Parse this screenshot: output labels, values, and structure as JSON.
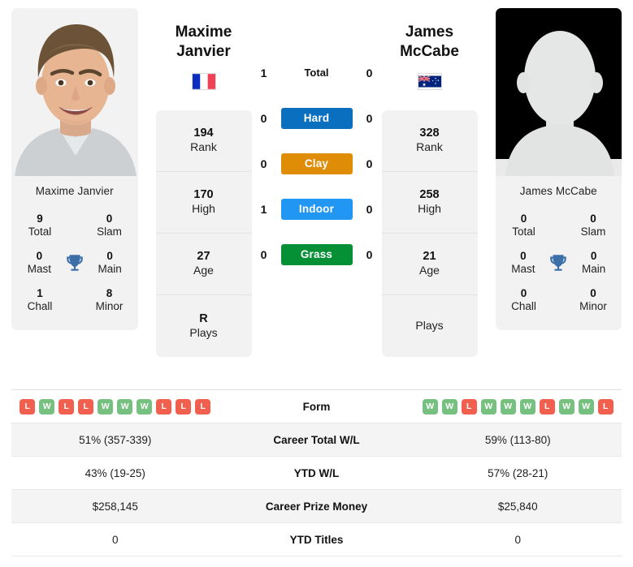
{
  "players": {
    "left": {
      "first_name": "Maxime",
      "last_name": "Janvier",
      "full_name": "Maxime Janvier",
      "country": "France",
      "flag": "fr-flag",
      "photo": "player-photo-janvier",
      "rank": "194",
      "rank_label": "Rank",
      "high": "170",
      "high_label": "High",
      "age": "27",
      "age_label": "Age",
      "plays": "R",
      "plays_label": "Plays",
      "titles": {
        "total_value": "9",
        "total_label": "Total",
        "slam_value": "0",
        "slam_label": "Slam",
        "mast_value": "0",
        "mast_label": "Mast",
        "main_value": "0",
        "main_label": "Main",
        "chall_value": "1",
        "chall_label": "Chall",
        "minor_value": "8",
        "minor_label": "Minor"
      },
      "form": [
        "L",
        "W",
        "L",
        "L",
        "W",
        "W",
        "W",
        "L",
        "L",
        "L"
      ],
      "career_wl": "51% (357-339)",
      "ytd_wl": "43% (19-25)",
      "career_prize": "$258,145",
      "ytd_titles": "0"
    },
    "right": {
      "first_name": "James",
      "last_name": "McCabe",
      "full_name": "James McCabe",
      "country": "Australia",
      "flag": "au-flag",
      "photo": "player-photo-placeholder",
      "rank": "328",
      "rank_label": "Rank",
      "high": "258",
      "high_label": "High",
      "age": "21",
      "age_label": "Age",
      "plays": "",
      "plays_label": "Plays",
      "titles": {
        "total_value": "0",
        "total_label": "Total",
        "slam_value": "0",
        "slam_label": "Slam",
        "mast_value": "0",
        "mast_label": "Mast",
        "main_value": "0",
        "main_label": "Main",
        "chall_value": "0",
        "chall_label": "Chall",
        "minor_value": "0",
        "minor_label": "Minor"
      },
      "form": [
        "W",
        "W",
        "L",
        "W",
        "W",
        "W",
        "L",
        "W",
        "W",
        "L"
      ],
      "career_wl": "59% (113-80)",
      "ytd_wl": "57% (28-21)",
      "career_prize": "$25,840",
      "ytd_titles": "0"
    }
  },
  "h2h": {
    "rows": [
      {
        "label": "Total",
        "left": "1",
        "right": "0",
        "type": "total",
        "color": ""
      },
      {
        "label": "Hard",
        "left": "0",
        "right": "0",
        "type": "surface",
        "color": "#0b6fbf"
      },
      {
        "label": "Clay",
        "left": "0",
        "right": "0",
        "type": "surface",
        "color": "#df8c06"
      },
      {
        "label": "Indoor",
        "left": "1",
        "right": "0",
        "type": "surface",
        "color": "#2196f3"
      },
      {
        "label": "Grass",
        "left": "0",
        "right": "0",
        "type": "surface",
        "color": "#069036"
      }
    ]
  },
  "table": {
    "rows": [
      {
        "label": "Form",
        "key": "form",
        "kind": "badges"
      },
      {
        "label": "Career Total W/L",
        "key": "career_wl",
        "kind": "text"
      },
      {
        "label": "YTD W/L",
        "key": "ytd_wl",
        "kind": "text"
      },
      {
        "label": "Career Prize Money",
        "key": "career_prize",
        "kind": "text"
      },
      {
        "label": "YTD Titles",
        "key": "ytd_titles",
        "kind": "text"
      }
    ]
  },
  "colors": {
    "form_win": "#76c080",
    "form_loss": "#f1604f",
    "trophy": "#3c6fa8",
    "card_bg": "#f2f2f2",
    "row_alt": "#f4f4f4"
  }
}
